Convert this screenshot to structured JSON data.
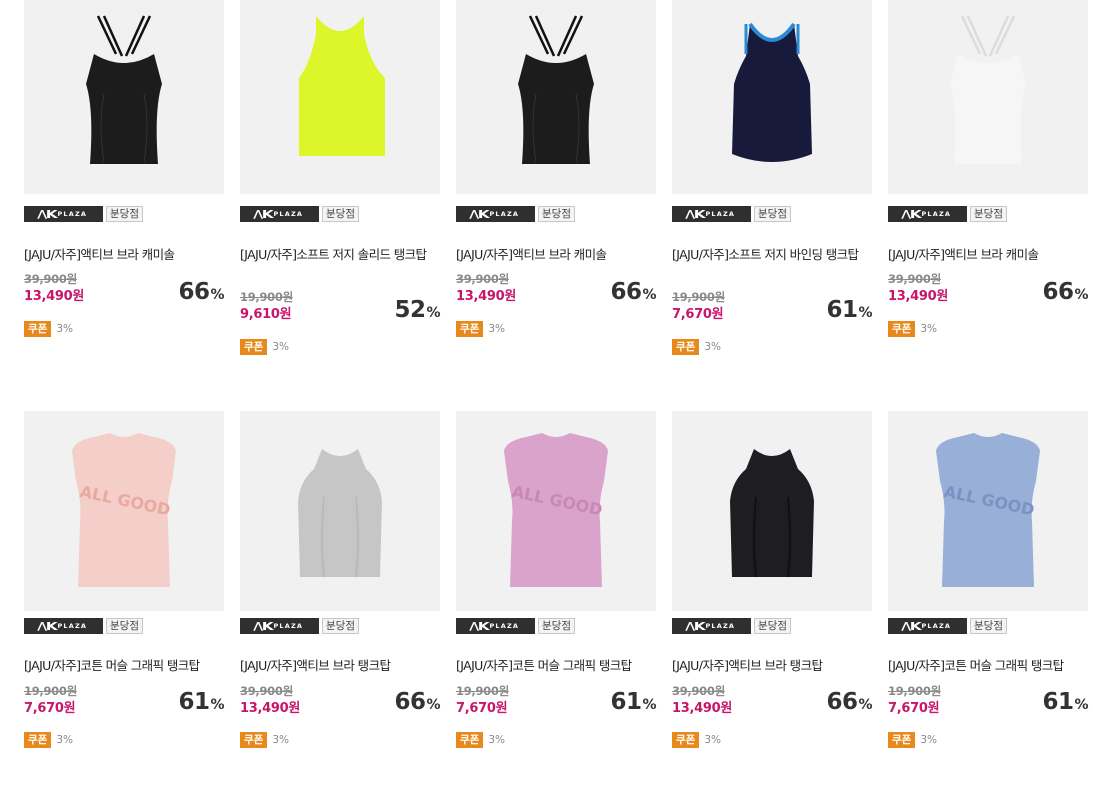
{
  "shop_logo": {
    "mark": "/\\K",
    "sub": "PLAZA"
  },
  "products": [
    {
      "title": "[JAJU/자주]액티브 브라 캐미솔",
      "original_price": "39,900원",
      "sale_price": "13,490원",
      "discount": "66",
      "pct": "%",
      "branch": "분당점",
      "coupon_label": "쿠폰",
      "coupon_pct": "3%",
      "image": "black-strappy-cami",
      "garment_color": "#1c1c1c",
      "title_lines": 1
    },
    {
      "title": "[JAJU/자주]소프트 저지 솔리드 탱크탑",
      "original_price": "19,900원",
      "sale_price": "9,610원",
      "discount": "52",
      "pct": "%",
      "branch": "분당점",
      "coupon_label": "쿠폰",
      "coupon_pct": "3%",
      "image": "neon-yellow-tank",
      "garment_color": "#dcf62a",
      "title_lines": 2
    },
    {
      "title": "[JAJU/자주]액티브 브라 캐미솔",
      "original_price": "39,900원",
      "sale_price": "13,490원",
      "discount": "66",
      "pct": "%",
      "branch": "분당점",
      "coupon_label": "쿠폰",
      "coupon_pct": "3%",
      "image": "black-strappy-cami",
      "garment_color": "#1c1c1c",
      "title_lines": 1
    },
    {
      "title": "[JAJU/자주]소프트 저지 바인딩 탱크탑",
      "original_price": "19,900원",
      "sale_price": "7,670원",
      "discount": "61",
      "pct": "%",
      "branch": "분당점",
      "coupon_label": "쿠폰",
      "coupon_pct": "3%",
      "image": "navy-binding-tank",
      "garment_color": "#171a3a",
      "title_lines": 2
    },
    {
      "title": "[JAJU/자주]액티브 브라 캐미솔",
      "original_price": "39,900원",
      "sale_price": "13,490원",
      "discount": "66",
      "pct": "%",
      "branch": "분당점",
      "coupon_label": "쿠폰",
      "coupon_pct": "3%",
      "image": "white-strappy-cami",
      "garment_color": "#f6f6f6",
      "title_lines": 1
    },
    {
      "title": "[JAJU/자주]코튼 머슬 그래픽 탱크탑",
      "original_price": "19,900원",
      "sale_price": "7,670원",
      "discount": "61",
      "pct": "%",
      "branch": "분당점",
      "coupon_label": "쿠폰",
      "coupon_pct": "3%",
      "image": "pink-muscle-tank",
      "garment_color": "#f4cfc9",
      "graphic_text": "ALL GOOD",
      "graphic_color": "#e9a8a0",
      "title_lines": 1
    },
    {
      "title": "[JAJU/자주]액티브 브라 탱크탑",
      "original_price": "39,900원",
      "sale_price": "13,490원",
      "discount": "66",
      "pct": "%",
      "branch": "분당점",
      "coupon_label": "쿠폰",
      "coupon_pct": "3%",
      "image": "gray-racer-tank",
      "garment_color": "#c6c6c6",
      "title_lines": 1
    },
    {
      "title": "[JAJU/자주]코튼 머슬 그래픽 탱크탑",
      "original_price": "19,900원",
      "sale_price": "7,670원",
      "discount": "61",
      "pct": "%",
      "branch": "분당점",
      "coupon_label": "쿠폰",
      "coupon_pct": "3%",
      "image": "mauve-muscle-tank",
      "garment_color": "#d9a3cb",
      "graphic_text": "ALL GOOD",
      "graphic_color": "#c987b5",
      "title_lines": 1
    },
    {
      "title": "[JAJU/자주]액티브 브라 탱크탑",
      "original_price": "39,900원",
      "sale_price": "13,490원",
      "discount": "66",
      "pct": "%",
      "branch": "분당점",
      "coupon_label": "쿠폰",
      "coupon_pct": "3%",
      "image": "black-racer-tank",
      "garment_color": "#1e1d22",
      "title_lines": 1
    },
    {
      "title": "[JAJU/자주]코튼 머슬 그래픽 탱크탑",
      "original_price": "19,900원",
      "sale_price": "7,670원",
      "discount": "61",
      "pct": "%",
      "branch": "분당점",
      "coupon_label": "쿠폰",
      "coupon_pct": "3%",
      "image": "blue-muscle-tank",
      "garment_color": "#98afd8",
      "graphic_text": "ALL GOOD",
      "graphic_color": "#7b93c4",
      "title_lines": 1
    }
  ]
}
